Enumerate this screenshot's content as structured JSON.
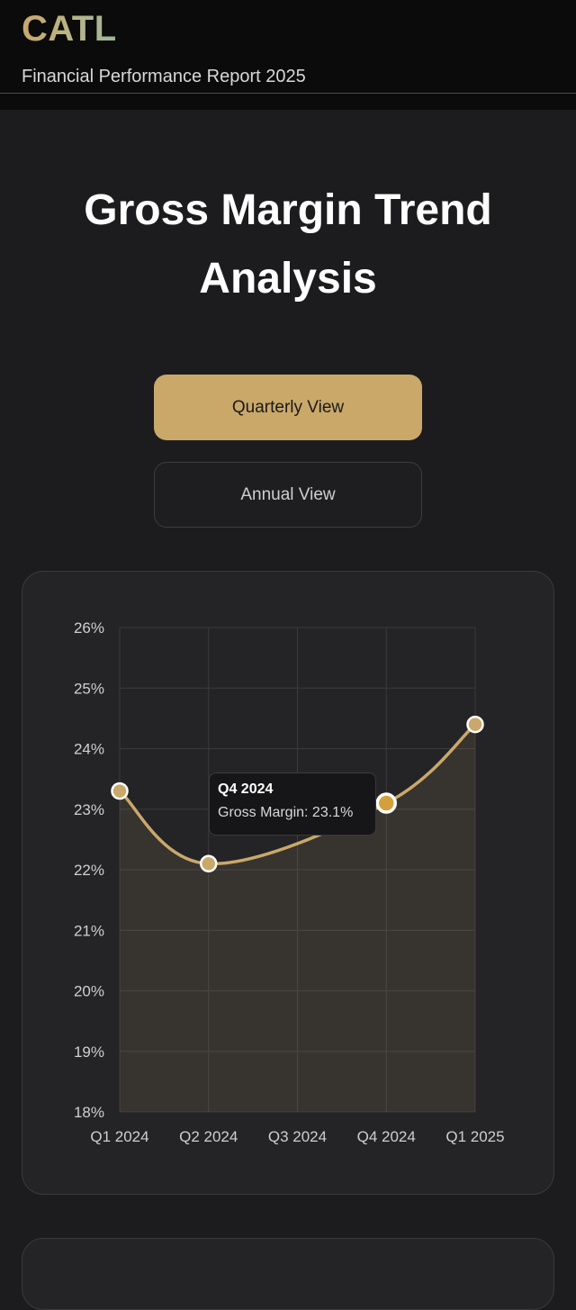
{
  "header": {
    "logo": "CATL",
    "subtitle": "Financial Performance Report 2025"
  },
  "page": {
    "title": "Gross Margin Trend Analysis"
  },
  "buttons": {
    "quarterly": "Quarterly View",
    "annual": "Annual View"
  },
  "tooltip": {
    "title": "Q4 2024",
    "series_label": "Gross Margin",
    "value_text": "23.1%"
  },
  "colors": {
    "accent": "#c9a86a",
    "point_active": "#d4a03c",
    "background": "#1c1c1e",
    "card": "#242427"
  },
  "chart_data": {
    "type": "line",
    "categories": [
      "Q1 2024",
      "Q2 2024",
      "Q3 2024",
      "Q4 2024",
      "Q1 2025"
    ],
    "series": [
      {
        "name": "Gross Margin",
        "values": [
          23.3,
          22.1,
          null,
          23.1,
          24.4
        ]
      }
    ],
    "yticks": [
      "18%",
      "19%",
      "20%",
      "21%",
      "22%",
      "23%",
      "24%",
      "25%",
      "26%"
    ],
    "ylim": [
      18,
      26
    ],
    "grid": true,
    "fill": true,
    "active_index": 3
  }
}
